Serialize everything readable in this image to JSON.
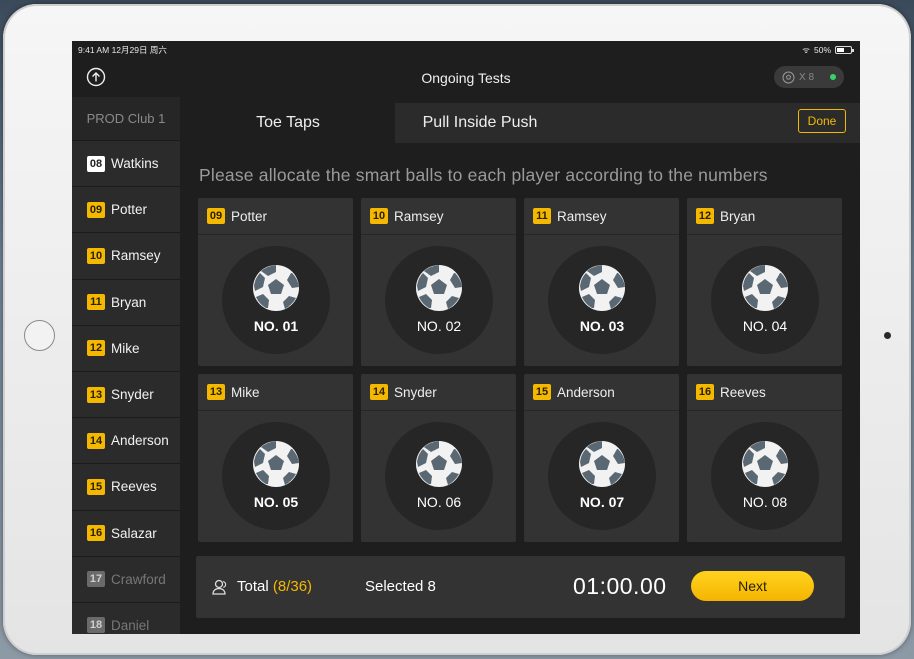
{
  "status_bar": {
    "time": "9:41 AM",
    "date": "12月29日 周六",
    "battery": "50%"
  },
  "nav": {
    "title": "Ongoing Tests",
    "balls_count": "X 8"
  },
  "sidebar": {
    "club": "PROD Club 1",
    "players": [
      {
        "num": "08",
        "name": "Watkins",
        "style": "white"
      },
      {
        "num": "09",
        "name": "Potter",
        "style": "yellow"
      },
      {
        "num": "10",
        "name": "Ramsey",
        "style": "yellow"
      },
      {
        "num": "11",
        "name": "Bryan",
        "style": "yellow"
      },
      {
        "num": "12",
        "name": "Mike",
        "style": "yellow"
      },
      {
        "num": "13",
        "name": "Snyder",
        "style": "yellow"
      },
      {
        "num": "14",
        "name": "Anderson",
        "style": "yellow"
      },
      {
        "num": "15",
        "name": "Reeves",
        "style": "yellow"
      },
      {
        "num": "16",
        "name": "Salazar",
        "style": "yellow"
      },
      {
        "num": "17",
        "name": "Crawford",
        "style": "grey"
      },
      {
        "num": "18",
        "name": "Daniel",
        "style": "grey"
      }
    ]
  },
  "tabs": {
    "active": "Toe Taps",
    "second": "Pull Inside Push",
    "done": "Done"
  },
  "instruction": "Please allocate the smart balls to each player according to the numbers",
  "cards": [
    {
      "num": "09",
      "name": "Potter",
      "ball": "NO. 01",
      "bold": true
    },
    {
      "num": "10",
      "name": "Ramsey",
      "ball": "NO. 02",
      "bold": false
    },
    {
      "num": "11",
      "name": "Ramsey",
      "ball": "NO. 03",
      "bold": true
    },
    {
      "num": "12",
      "name": "Bryan",
      "ball": "NO. 04",
      "bold": false
    },
    {
      "num": "13",
      "name": "Mike",
      "ball": "NO. 05",
      "bold": true
    },
    {
      "num": "14",
      "name": "Snyder",
      "ball": "NO. 06",
      "bold": false
    },
    {
      "num": "15",
      "name": "Anderson",
      "ball": "NO. 07",
      "bold": true
    },
    {
      "num": "16",
      "name": "Reeves",
      "ball": "NO. 08",
      "bold": false
    }
  ],
  "footer": {
    "total_label": "Total",
    "total_value": "(8/36)",
    "selected": "Selected 8",
    "timer": "01:00.00",
    "next": "Next"
  },
  "colors": {
    "accent": "#f5b800",
    "connected": "#36d36a",
    "background": "#1e1e1e"
  }
}
